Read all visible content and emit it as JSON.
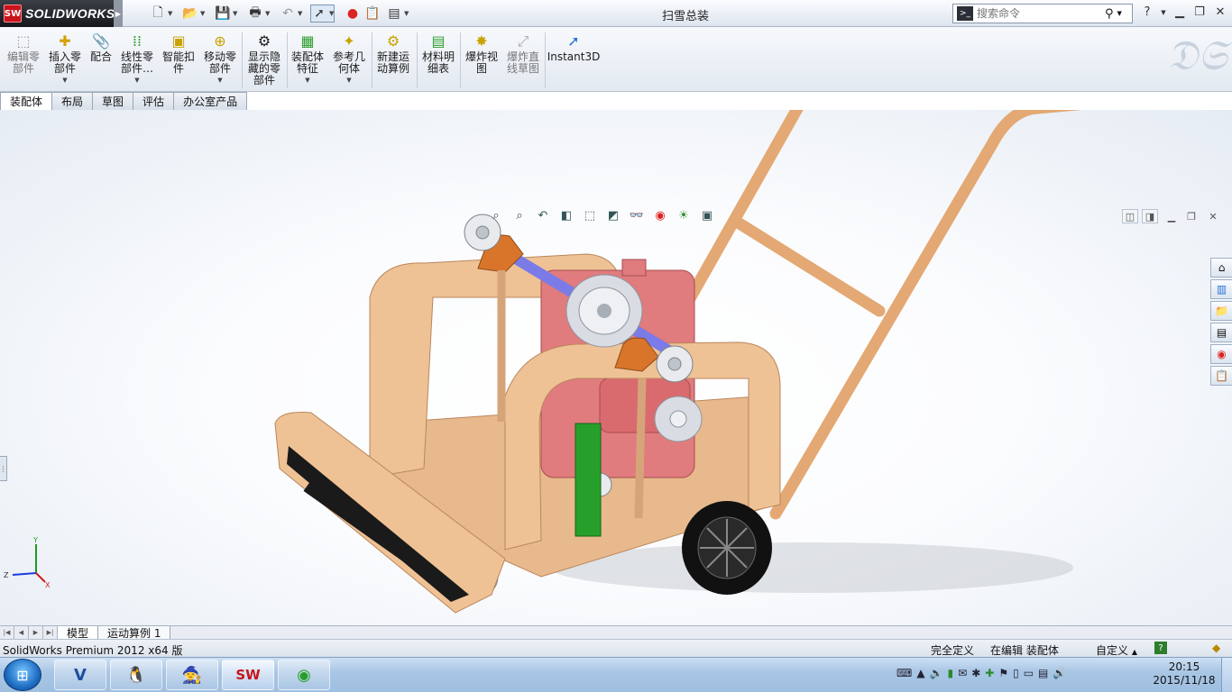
{
  "app": {
    "logo_badge": "SW",
    "logo_text": "SOLIDWORKS",
    "doc_title": "扫雪总装"
  },
  "search": {
    "placeholder": "搜索命令"
  },
  "commands": [
    {
      "label": "编辑零\n部件",
      "icon": "edit-component-icon",
      "disabled": true
    },
    {
      "label": "插入零\n部件",
      "icon": "insert-component-icon",
      "disabled": false
    },
    {
      "label": "配合",
      "icon": "mate-icon",
      "disabled": false
    },
    {
      "label": "线性零\n部件…",
      "icon": "linear-pattern-icon",
      "disabled": false
    },
    {
      "label": "智能扣\n件",
      "icon": "smart-fastener-icon",
      "disabled": false
    },
    {
      "label": "移动零\n部件",
      "icon": "move-component-icon",
      "disabled": false
    },
    {
      "label": "显示隐\n藏的零\n部件",
      "icon": "show-hidden-icon",
      "disabled": false
    },
    {
      "label": "装配体\n特征",
      "icon": "assembly-feature-icon",
      "disabled": false
    },
    {
      "label": "参考几\n何体",
      "icon": "reference-geometry-icon",
      "disabled": false
    },
    {
      "label": "新建运\n动算例",
      "icon": "motion-study-icon",
      "disabled": false
    },
    {
      "label": "材料明\n细表",
      "icon": "bom-icon",
      "disabled": false
    },
    {
      "label": "爆炸视\n图",
      "icon": "exploded-view-icon",
      "disabled": false
    },
    {
      "label": "爆炸直\n线草图",
      "icon": "explode-line-icon",
      "disabled": true
    },
    {
      "label": "Instant3D",
      "icon": "instant3d-icon",
      "disabled": false
    }
  ],
  "tabs": [
    "装配体",
    "布局",
    "草图",
    "评估",
    "办公室产品"
  ],
  "bottom_tabs": [
    "模型",
    "运动算例 1"
  ],
  "status": {
    "product": "SolidWorks Premium 2012 x64 版",
    "definition": "完全定义",
    "editing": "在编辑 装配体",
    "custom": "自定义"
  },
  "clock": {
    "time": "20:15",
    "date": "2015/11/18"
  },
  "colors": {
    "frame": "#e8b98c",
    "engine": "#e07b7e",
    "shaft": "#7b7be8",
    "gear_strip": "#1f8f1f",
    "wheel": "#111111"
  }
}
